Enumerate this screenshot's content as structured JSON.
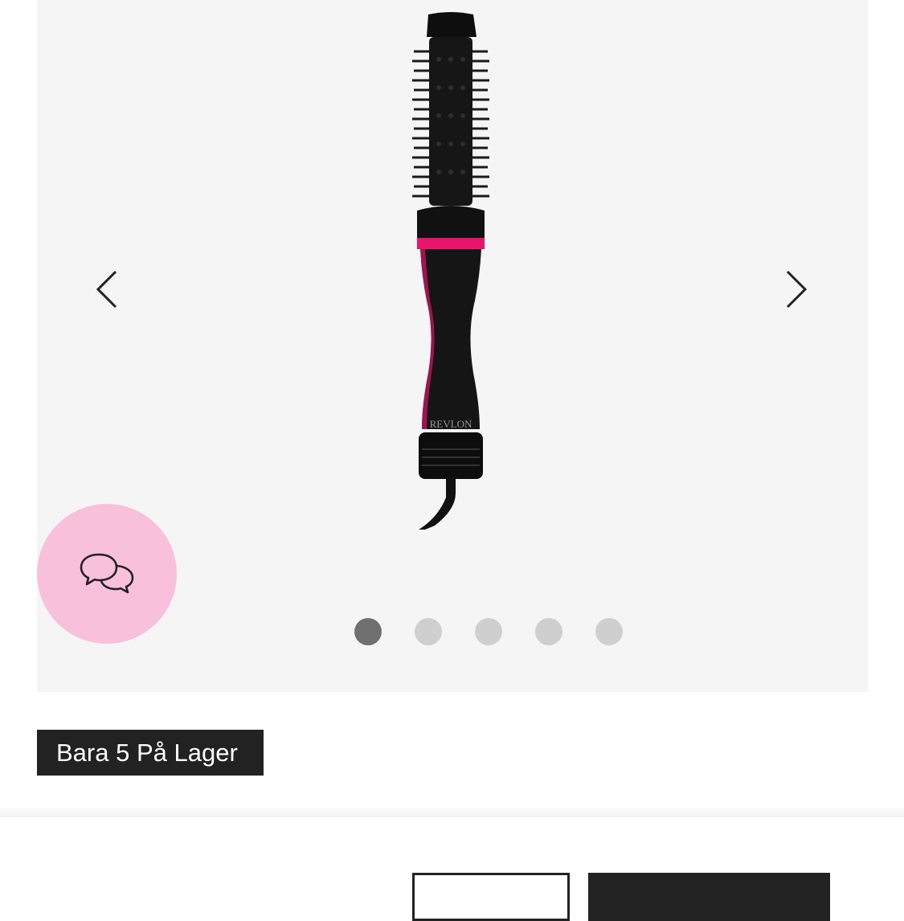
{
  "gallery": {
    "product_alt": "Revlon one-step round brush",
    "brand_mark": "REVLON",
    "prev_icon": "chevron-left-icon",
    "next_icon": "chevron-right-icon",
    "dot_count": 5,
    "active_index": 0
  },
  "chat": {
    "icon": "chat-bubbles-icon"
  },
  "stock": {
    "label": "Bara 5 På Lager"
  },
  "colors": {
    "accent_pink": "#f9c0dc",
    "brand_pink": "#e8156d",
    "dark": "#222222"
  }
}
